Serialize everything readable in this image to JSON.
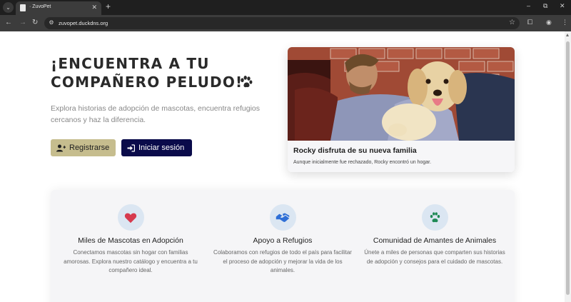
{
  "browser": {
    "tab_title": "· ZuvoPet",
    "url": "zuvopet.duckdns.org",
    "controls": {
      "minimize": "–",
      "restore": "⧉",
      "close": "✕",
      "new_tab": "+",
      "tab_close": "✕"
    }
  },
  "hero": {
    "title_line1": "¡ENCUENTRA A TU",
    "title_line2": "COMPAÑERO PELUDO!",
    "subtitle": "Explora historias de adopción de mascotas, encuentra refugios cercanos y haz la diferencia.",
    "register_label": "Registrarse",
    "login_label": "Iniciar sesión"
  },
  "featured_story": {
    "title": "Rocky disfruta de su nueva familia",
    "text": "Aunque inicialmente fue rechazado, Rocky encontró un hogar."
  },
  "features": [
    {
      "icon": "heart-icon",
      "title": "Miles de Mascotas en Adopción",
      "text": "Conectamos mascotas sin hogar con familias amorosas. Explora nuestro catálogo y encuentra a tu compañero ideal."
    },
    {
      "icon": "handshake-icon",
      "title": "Apoyo a Refugios",
      "text": "Colaboramos con refugios de todo el país para facilitar el proceso de adopción y mejorar la vida de los animales."
    },
    {
      "icon": "paw-icon",
      "title": "Comunidad de Amantes de Animales",
      "text": "Únete a miles de personas que comparten sus historias de adopción y consejos para el cuidado de mascotas."
    }
  ],
  "colors": {
    "register_button": "#c6bd8e",
    "login_button": "#0a0b4a",
    "heart": "#d63a4e",
    "handshake": "#2f6fd6",
    "paw": "#1e8a55",
    "feature_icon_bg": "#dbe6f2"
  }
}
